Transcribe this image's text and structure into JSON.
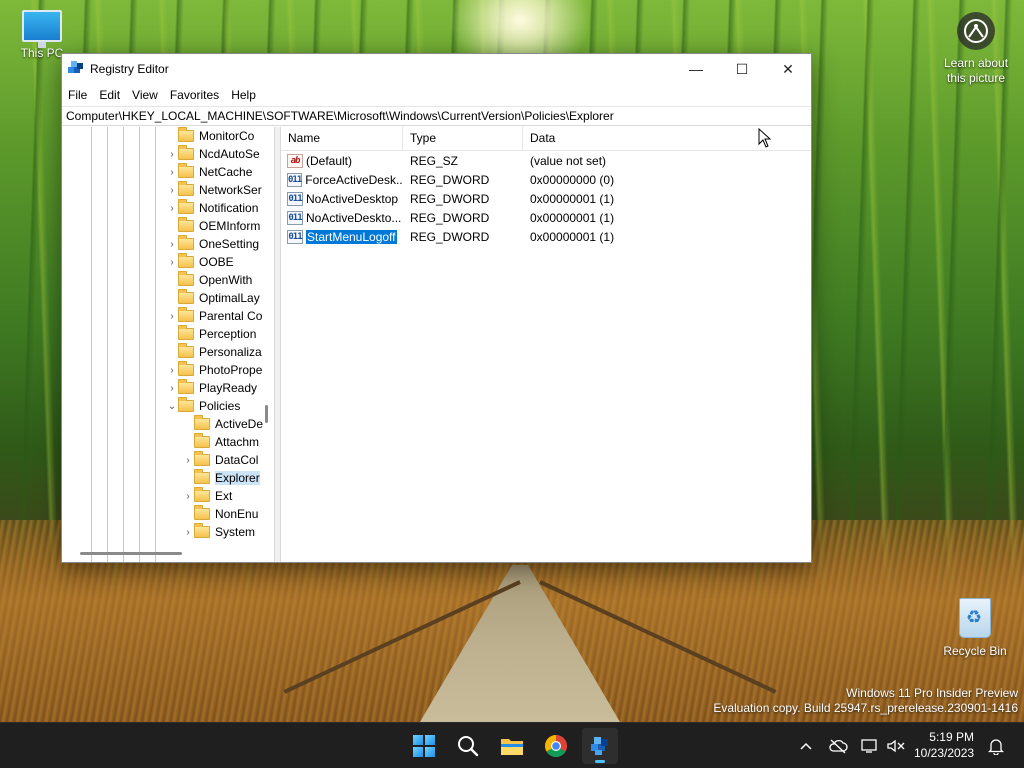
{
  "desktop": {
    "this_pc_label": "This PC",
    "learn_label": "Learn about this picture",
    "recycle_label": "Recycle Bin",
    "watermark_line1": "Windows 11 Pro Insider Preview",
    "watermark_line2": "Evaluation copy. Build 25947.rs_prerelease.230901-1416"
  },
  "window": {
    "title": "Registry Editor",
    "minimize_glyph": "—",
    "maximize_glyph": "☐",
    "close_glyph": "✕",
    "menu": [
      "File",
      "Edit",
      "View",
      "Favorites",
      "Help"
    ],
    "address": "Computer\\HKEY_LOCAL_MACHINE\\SOFTWARE\\Microsoft\\Windows\\CurrentVersion\\Policies\\Explorer"
  },
  "tree": {
    "items": [
      {
        "label": "MonitorCo",
        "expander": ""
      },
      {
        "label": "NcdAutoSe",
        "expander": "›"
      },
      {
        "label": "NetCache",
        "expander": "›"
      },
      {
        "label": "NetworkSer",
        "expander": "›"
      },
      {
        "label": "Notification",
        "expander": "›"
      },
      {
        "label": "OEMInform",
        "expander": ""
      },
      {
        "label": "OneSetting",
        "expander": "›"
      },
      {
        "label": "OOBE",
        "expander": "›"
      },
      {
        "label": "OpenWith",
        "expander": ""
      },
      {
        "label": "OptimalLay",
        "expander": ""
      },
      {
        "label": "Parental Co",
        "expander": "›"
      },
      {
        "label": "Perception",
        "expander": ""
      },
      {
        "label": "Personaliza",
        "expander": ""
      },
      {
        "label": "PhotoPrope",
        "expander": "›"
      },
      {
        "label": "PlayReady",
        "expander": "›"
      },
      {
        "label": "Policies",
        "expander": "⌄"
      },
      {
        "label": "ActiveDe",
        "expander": ""
      },
      {
        "label": "Attachm",
        "expander": ""
      },
      {
        "label": "DataCol",
        "expander": "›"
      },
      {
        "label": "Explorer",
        "expander": ""
      },
      {
        "label": "Ext",
        "expander": "›"
      },
      {
        "label": "NonEnu",
        "expander": ""
      },
      {
        "label": "System",
        "expander": "›"
      }
    ]
  },
  "list": {
    "columns": [
      "Name",
      "Type",
      "Data"
    ],
    "rows": [
      {
        "icon": "ab",
        "name": "(Default)",
        "type": "REG_SZ",
        "data": "(value not set)"
      },
      {
        "icon": "011",
        "name": "ForceActiveDesk...",
        "type": "REG_DWORD",
        "data": "0x00000000 (0)"
      },
      {
        "icon": "011",
        "name": "NoActiveDesktop",
        "type": "REG_DWORD",
        "data": "0x00000001 (1)"
      },
      {
        "icon": "011",
        "name": "NoActiveDeskto...",
        "type": "REG_DWORD",
        "data": "0x00000001 (1)"
      },
      {
        "icon": "011",
        "name": "StartMenuLogoff",
        "type": "REG_DWORD",
        "data": "0x00000001 (1)"
      }
    ]
  },
  "taskbar": {
    "icons": [
      "start-icon",
      "search-icon",
      "file-explorer-icon",
      "chrome-icon",
      "registry-editor-icon"
    ],
    "time": "5:19 PM",
    "date": "10/23/2023"
  },
  "colors": {
    "selection": "#0078d7",
    "taskbar": "#1f1f1f",
    "accent": "#4cc2ff"
  }
}
